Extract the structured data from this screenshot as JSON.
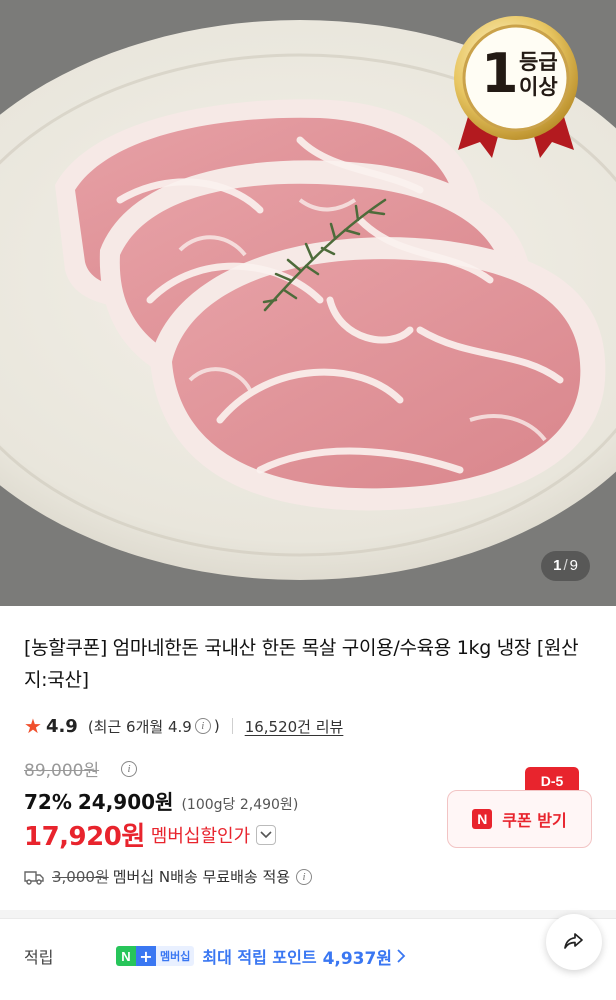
{
  "gallery": {
    "current": "1",
    "separator": "/",
    "total": "9",
    "grade_badge": {
      "number": "1",
      "line1": "등급",
      "line2": "이상"
    }
  },
  "product": {
    "title": "[농할쿠폰] 엄마네한돈 국내산 한돈 목살 구이용/수육용 1kg 냉장 [원산지:국산]",
    "rating": "4.9",
    "rating_note_prefix": "(최근 6개월 4.9",
    "rating_note_suffix": ")",
    "reviews": "16,520건 리뷰"
  },
  "price": {
    "original": "89,000원",
    "discount": "72%",
    "sale": "24,900원",
    "unit": "(100g당 2,490원)",
    "member_price": "17,920원",
    "member_label": "멤버십할인가"
  },
  "coupon": {
    "badge": "D-5",
    "icon": "N",
    "label": "쿠폰 받기"
  },
  "shipping": {
    "original_fee": "3,000원",
    "text": "멤버십 N배송 무료배송 적용"
  },
  "points": {
    "label": "적립",
    "badge_n": "N",
    "badge_plus": "+",
    "badge_text": "멤버십",
    "text": "최대 적립 포인트",
    "value": "4,937원"
  },
  "colors": {
    "accent_red": "#e8242d",
    "points_blue": "#3a77f2",
    "naver_green": "#27c55a",
    "star": "#f0502d"
  },
  "icons": [
    "star-icon",
    "info-icon",
    "chevron-down-icon",
    "truck-icon",
    "chevron-right-icon",
    "share-icon"
  ]
}
